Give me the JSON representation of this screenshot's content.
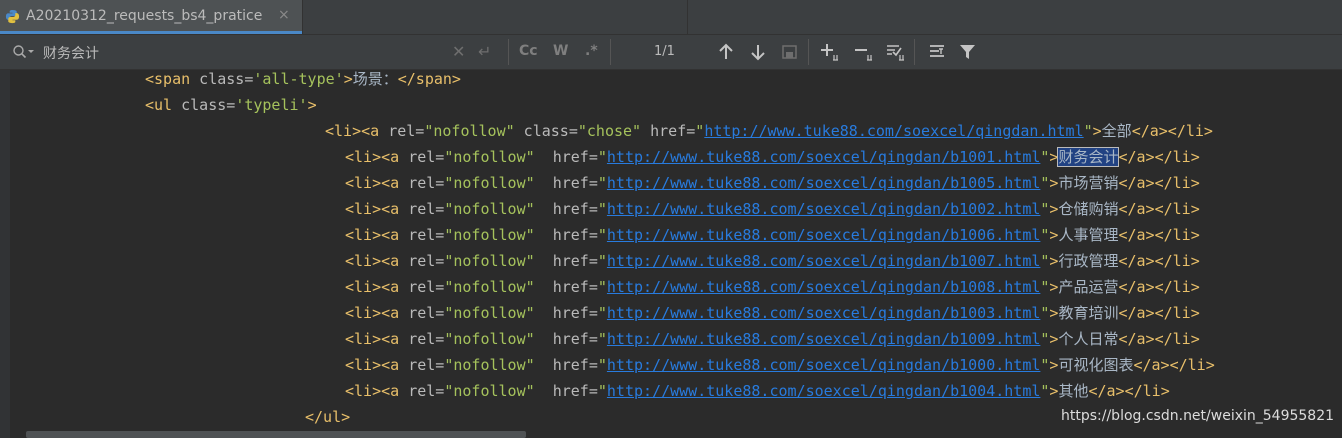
{
  "tab": {
    "title": "A20210312_requests_bs4_pratice",
    "close": "×",
    "icon": "python-file-icon"
  },
  "find": {
    "query": "财务会计",
    "clear": "✕",
    "newline": "↵",
    "match_case": "Cc",
    "words": "W",
    "regex": ".*",
    "count": "1/1",
    "icons": [
      "search-icon",
      "clear-icon",
      "newline-icon",
      "prev-occurrence-icon",
      "next-occurrence-icon",
      "select-all-icon",
      "add-selection-icon",
      "remove-selection-icon",
      "select-all-occurrences-icon",
      "filter-settings-icon",
      "filter-icon"
    ]
  },
  "code": {
    "span": {
      "open": "<span",
      "attr": " class=",
      "val": "'all-type'",
      "close": ">",
      "text": "场景：",
      "end": "</span>"
    },
    "ul": {
      "open": "<ul",
      "attr": " class=",
      "val": "'typeli'",
      "close": ">"
    },
    "first": {
      "li": "<li>",
      "a": "<a",
      "rel_attr": " rel=",
      "rel_val": "\"nofollow\"",
      "class_attr": " class=",
      "class_val": "\"chose\"",
      "href_attr": " href=",
      "q1": "\"",
      "url": "http://www.tuke88.com/soexcel/qingdan.html",
      "q2": "\"",
      "gt": ">",
      "text": "全部",
      "end": "</a></li>"
    },
    "item": {
      "li": "<li>",
      "a": "<a",
      "rel_attr": " rel=",
      "rel_val": "\"nofollow\"",
      "gap": "  ",
      "href_attr": "href=",
      "q": "\"",
      "gt": ">",
      "end": "</a></li>"
    },
    "items": [
      {
        "url": "http://www.tuke88.com/soexcel/qingdan/b1001.html",
        "text": "财务会计"
      },
      {
        "url": "http://www.tuke88.com/soexcel/qingdan/b1005.html",
        "text": "市场营销"
      },
      {
        "url": "http://www.tuke88.com/soexcel/qingdan/b1002.html",
        "text": "仓储购销"
      },
      {
        "url": "http://www.tuke88.com/soexcel/qingdan/b1006.html",
        "text": "人事管理"
      },
      {
        "url": "http://www.tuke88.com/soexcel/qingdan/b1007.html",
        "text": "行政管理"
      },
      {
        "url": "http://www.tuke88.com/soexcel/qingdan/b1008.html",
        "text": "产品运营"
      },
      {
        "url": "http://www.tuke88.com/soexcel/qingdan/b1003.html",
        "text": "教育培训"
      },
      {
        "url": "http://www.tuke88.com/soexcel/qingdan/b1009.html",
        "text": "个人日常"
      },
      {
        "url": "http://www.tuke88.com/soexcel/qingdan/b1000.html",
        "text": "可视化图表"
      },
      {
        "url": "http://www.tuke88.com/soexcel/qingdan/b1004.html",
        "text": "其他"
      }
    ],
    "ul_end": "</ul>"
  },
  "watermark": "https://blog.csdn.net/weixin_54955821"
}
